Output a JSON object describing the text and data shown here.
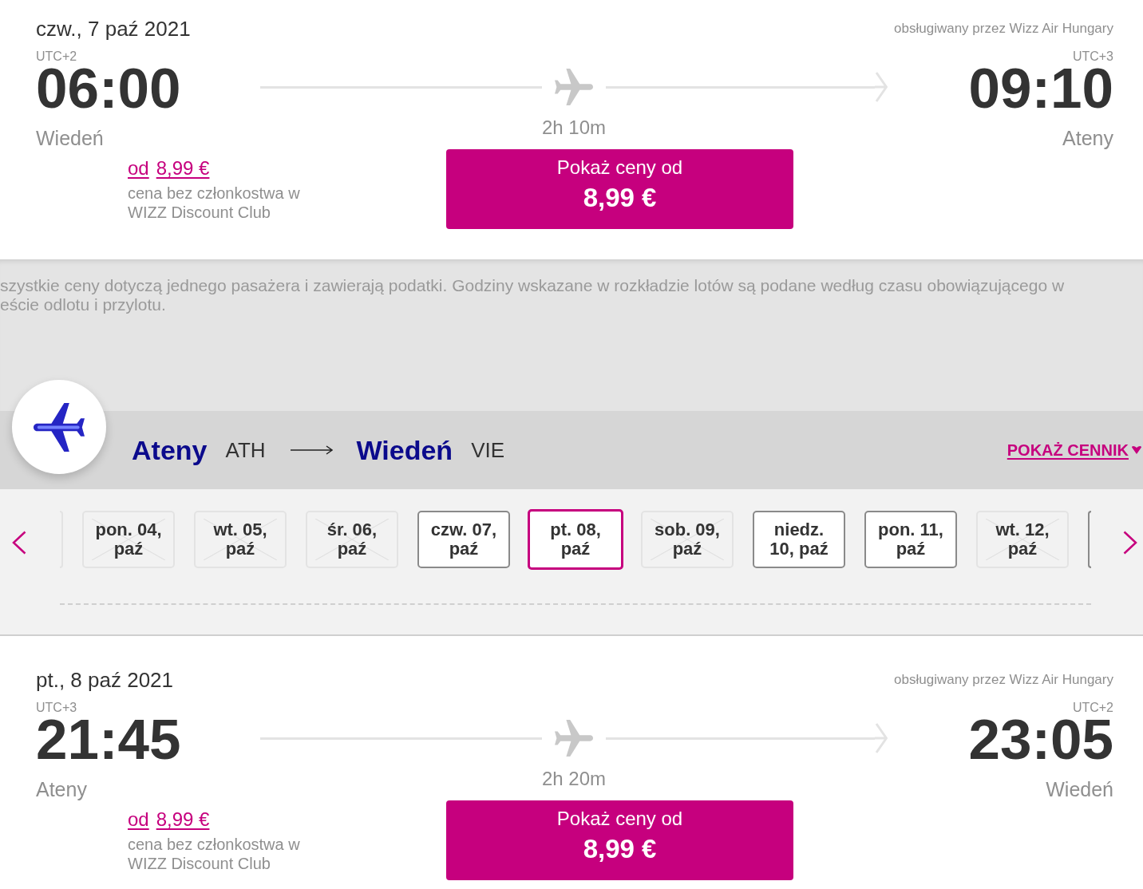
{
  "outbound_flight": {
    "date": "czw., 7 paź 2021",
    "operator": "obsługiwany przez Wizz Air Hungary",
    "departure": {
      "timezone": "UTC+2",
      "time": "06:00",
      "city": "Wiedeń"
    },
    "duration": "2h 10m",
    "arrival": {
      "timezone": "UTC+3",
      "time": "09:10",
      "city": "Ateny"
    },
    "price": {
      "prefix": "od",
      "amount": "8,99 €",
      "note": "cena bez członkostwa w WIZZ Discount Club"
    },
    "button": {
      "label": "Pokaż ceny od",
      "amount": "8,99 €"
    }
  },
  "notice": "szystkie ceny dotyczą jednego pasażera i zawierają podatki. Godziny wskazane w rozkładzie lotów są podane według czasu obowiązującego w\neście odlotu i przylotu.",
  "return_route": {
    "origin": {
      "city": "Ateny",
      "code": "ATH"
    },
    "destination": {
      "city": "Wiedeń",
      "code": "VIE"
    },
    "price_list_link": "POKAŻ CENNIK",
    "dates": {
      "edge_before": {
        "available": false
      },
      "items": [
        {
          "label": "pon. 04, paź",
          "available": false,
          "selected": false
        },
        {
          "label": "wt. 05, paź",
          "available": false,
          "selected": false
        },
        {
          "label": "śr. 06, paź",
          "available": false,
          "selected": false
        },
        {
          "label": "czw. 07, paź",
          "available": true,
          "selected": false
        },
        {
          "label": "pt. 08, paź",
          "available": true,
          "selected": true
        },
        {
          "label": "sob. 09, paź",
          "available": false,
          "selected": false
        },
        {
          "label": "niedz. 10, paź",
          "available": true,
          "selected": false
        },
        {
          "label": "pon. 11, paź",
          "available": true,
          "selected": false
        },
        {
          "label": "wt. 12, paź",
          "available": false,
          "selected": false
        }
      ],
      "edge_after": {
        "available": true
      }
    },
    "flight": {
      "date": "pt., 8 paź 2021",
      "operator": "obsługiwany przez Wizz Air Hungary",
      "departure": {
        "timezone": "UTC+3",
        "time": "21:45",
        "city": "Ateny"
      },
      "duration": "2h 20m",
      "arrival": {
        "timezone": "UTC+2",
        "time": "23:05",
        "city": "Wiedeń"
      },
      "price": {
        "prefix": "od",
        "amount": "8,99 €",
        "note": "cena bez członkostwa w WIZZ Discount Club"
      },
      "button": {
        "label": "Pokaż ceny od",
        "amount": "8,99 €"
      }
    }
  }
}
